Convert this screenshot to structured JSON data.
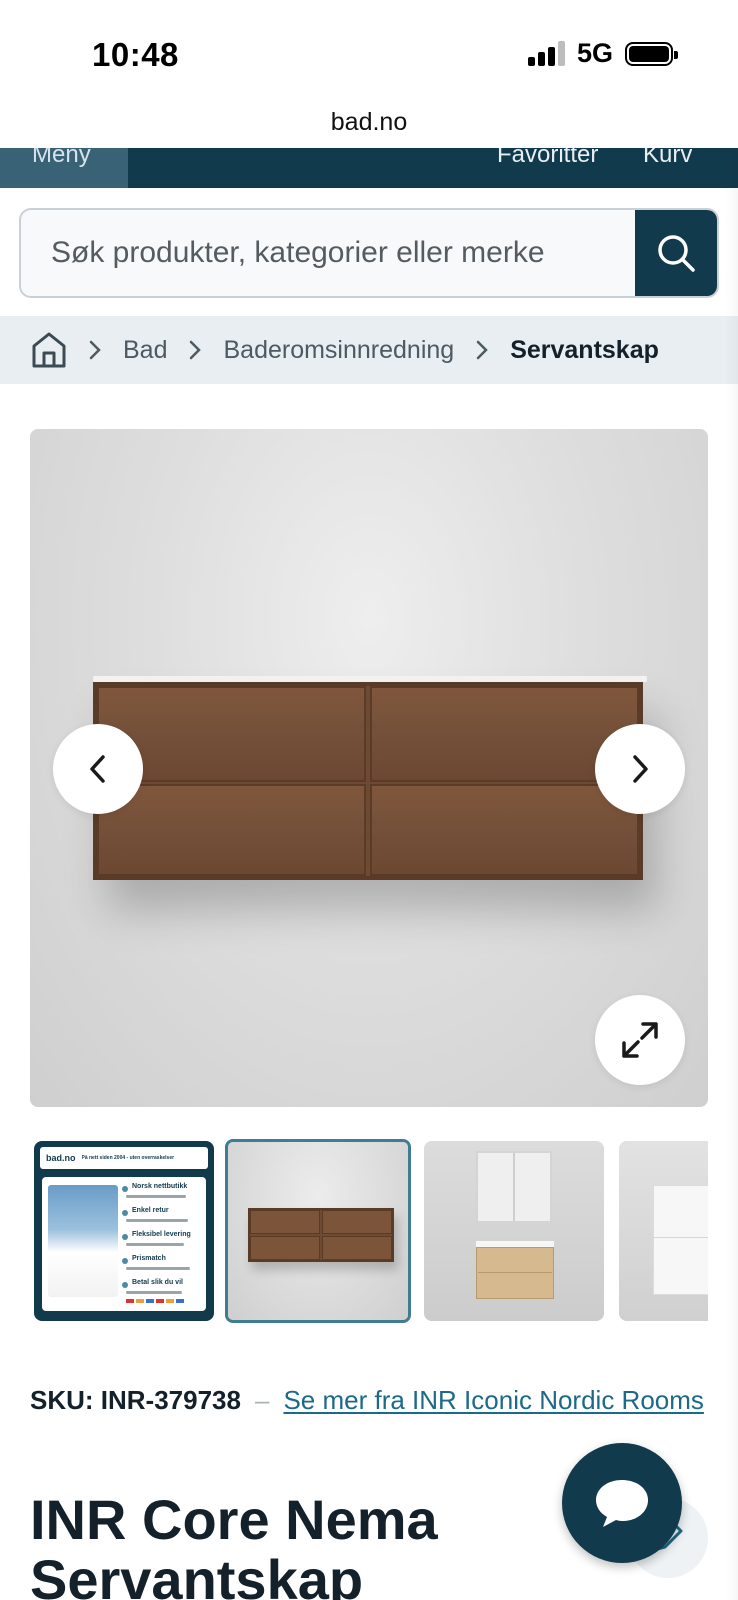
{
  "status_bar": {
    "time": "10:48",
    "network": "5G"
  },
  "browser": {
    "url": "bad.no"
  },
  "header": {
    "menu_label": "Meny",
    "favorites_label": "Favoritter",
    "cart_label": "Kurv"
  },
  "search": {
    "placeholder": "Søk produkter, kategorier eller merke",
    "value": ""
  },
  "breadcrumb": {
    "home_icon": "home-icon",
    "items": [
      "Bad",
      "Baderomsinnredning",
      "Servantskap"
    ]
  },
  "gallery": {
    "prev_icon": "chevron-left-icon",
    "next_icon": "chevron-right-icon",
    "fullscreen_icon": "expand-icon",
    "thumbnails": [
      {
        "kind": "promo",
        "brand": "bad.no",
        "tagline": "På nett siden 2004 - uten overraskelser",
        "bullets": [
          "Norsk nettbutikk",
          "Enkel retur",
          "Fleksibel levering",
          "Prismatch",
          "Betal slik du vil"
        ]
      },
      {
        "kind": "cabinet-wood"
      },
      {
        "kind": "cabinet-light-with-mirror"
      },
      {
        "kind": "cabinet-white"
      }
    ],
    "active_index": 1
  },
  "product": {
    "sku": "SKU: INR-379738",
    "separator": "–",
    "brand_link": "Se mer fra INR Iconic Nordic Rooms",
    "title_line1": "INR Core Nema",
    "title_line2": "Servantskap"
  },
  "colors": {
    "primary": "#123a4d",
    "link": "#1c6a88",
    "breadcrumb_bg": "#e8eef1"
  }
}
